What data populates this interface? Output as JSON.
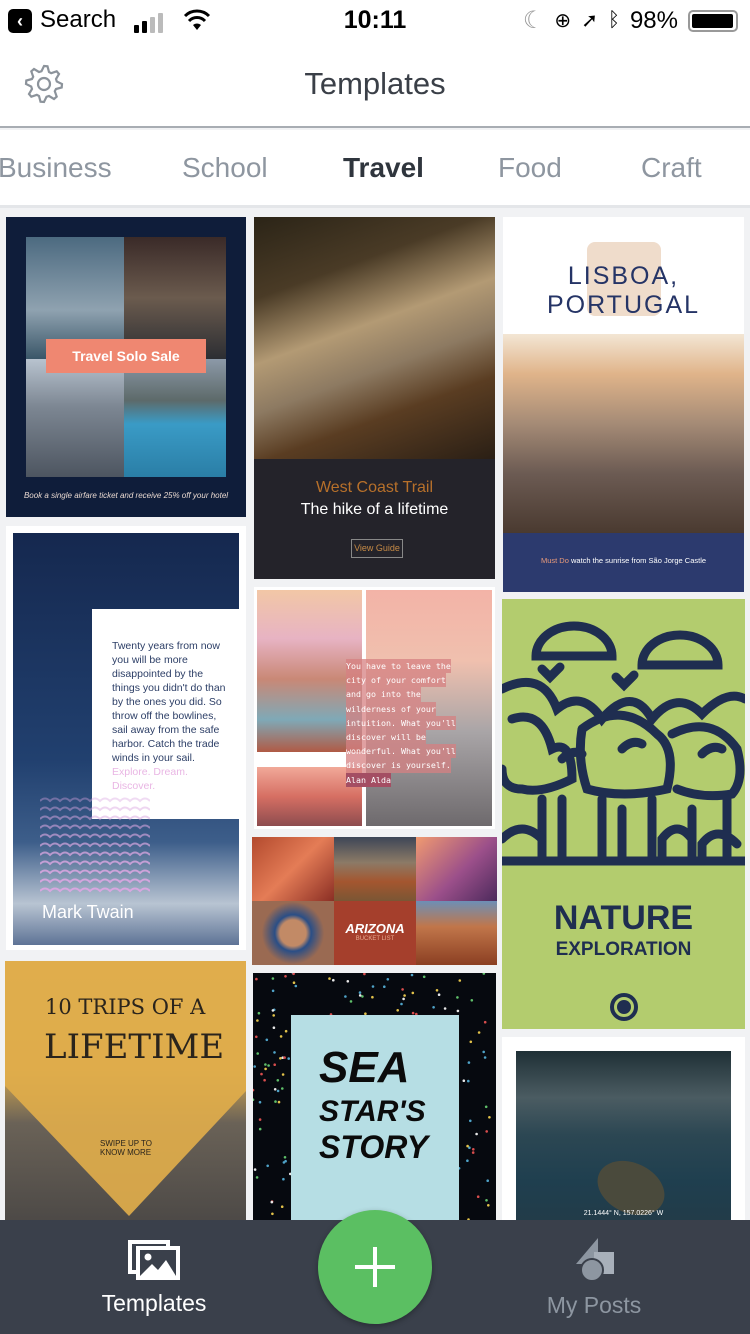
{
  "status_bar": {
    "back_label": "Search",
    "time": "10:11",
    "battery": "98%",
    "battery_level": 0.98
  },
  "header": {
    "title": "Templates",
    "settings_icon": "gear-icon"
  },
  "tabs": [
    {
      "label": "Business",
      "active": false
    },
    {
      "label": "School",
      "active": false
    },
    {
      "label": "Travel",
      "active": true
    },
    {
      "label": "Food",
      "active": false
    },
    {
      "label": "Craft",
      "active": false
    }
  ],
  "templates": {
    "travel_solo": {
      "title": "Travel Solo Sale",
      "caption": "Book a single airfare ticket and receive 25% off your hotel"
    },
    "west_coast": {
      "title": "West Coast Trail",
      "subtitle": "The hike of a lifetime",
      "button": "View Guide"
    },
    "lisboa": {
      "title": "LISBOA, PORTUGAL",
      "highlight": "Must Do",
      "caption": "watch the sunrise from São Jorge Castle"
    },
    "twain": {
      "quote": "Twenty years from now you will be more disappointed by the things you didn't do than by the ones you did. So throw off the bowlines, sail away from the safe harbor. Catch the trade winds in your sail.",
      "tagline": "Explore. Dream. Discover.",
      "author": "Mark Twain"
    },
    "alda": {
      "lines": [
        "You have to leave the",
        "city of your comfort",
        "and go into the",
        "wilderness of your",
        "intuition. What you'll",
        "discover will be",
        "wonderful. What you'll",
        "discover is yourself."
      ],
      "author": "Alan Alda"
    },
    "arizona": {
      "title": "ARIZONA",
      "subtitle": "BUCKET LIST"
    },
    "nature": {
      "title": "NATURE",
      "subtitle": "EXPLORATION"
    },
    "trips": {
      "line1": "10 TRIPS OF A",
      "line2": "LIFETIME",
      "cta1": "SWIPE UP TO",
      "cta2": "KNOW MORE"
    },
    "seastar": {
      "line1": "SEA",
      "line2": "STAR'S",
      "line3": "STORY"
    },
    "turtle": {
      "coords": "21.1444° N, 157.0226° W"
    }
  },
  "bottom_nav": {
    "templates_label": "Templates",
    "my_posts_label": "My Posts",
    "add_icon": "plus-icon"
  },
  "colors": {
    "accent_green": "#5bbf62",
    "nav_bg": "#3a404b",
    "active_tab": "#2f353d",
    "inactive_tab": "#8e96a0"
  }
}
